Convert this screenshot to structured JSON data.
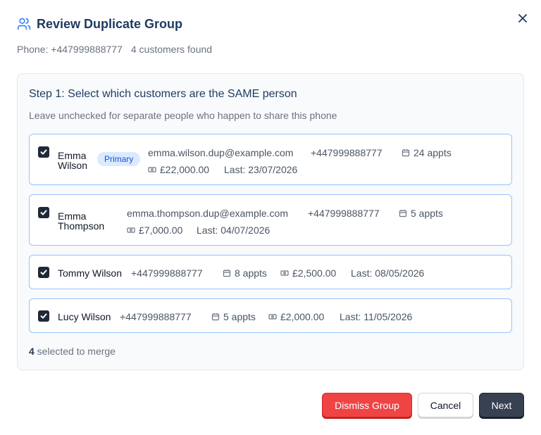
{
  "header": {
    "title": "Review Duplicate Group",
    "phone": "Phone: +447999888777",
    "count": "4 customers found"
  },
  "step": {
    "title": "Step 1: Select which customers are the SAME person",
    "hint": "Leave unchecked for separate people who happen to share this phone"
  },
  "customers": [
    {
      "name_line1": "Emma",
      "name_line2": "Wilson",
      "badge": "Primary",
      "email": "emma.wilson.dup@example.com",
      "phone": "+447999888777",
      "appts": "24 appts",
      "spend": "£22,000.00",
      "last": "Last: 23/07/2026",
      "checked": true
    },
    {
      "name_line1": "Emma",
      "name_line2": "Thompson",
      "email": "emma.thompson.dup@example.com",
      "phone": "+447999888777",
      "appts": "5 appts",
      "spend": "£7,000.00",
      "last": "Last: 04/07/2026",
      "checked": true
    },
    {
      "name": "Tommy Wilson",
      "phone": "+447999888777",
      "appts": "8 appts",
      "spend": "£2,500.00",
      "last": "Last: 08/05/2026",
      "checked": true
    },
    {
      "name": "Lucy Wilson",
      "phone": "+447999888777",
      "appts": "5 appts",
      "spend": "£2,000.00",
      "last": "Last: 11/05/2026",
      "checked": true
    }
  ],
  "footer": {
    "selected_count": "4",
    "selected_suffix": " selected to merge"
  },
  "buttons": {
    "dismiss": "Dismiss Group",
    "cancel": "Cancel",
    "next": "Next"
  },
  "colors": {
    "accent": "#1e3a5f",
    "card_border": "#93c5fd",
    "danger": "#ef4444",
    "primary_badge_bg": "#dbeafe"
  },
  "icons": {
    "title": "users-icon",
    "close": "close-icon",
    "appts": "calendar-icon",
    "spend": "money-icon",
    "check": "check-icon"
  }
}
